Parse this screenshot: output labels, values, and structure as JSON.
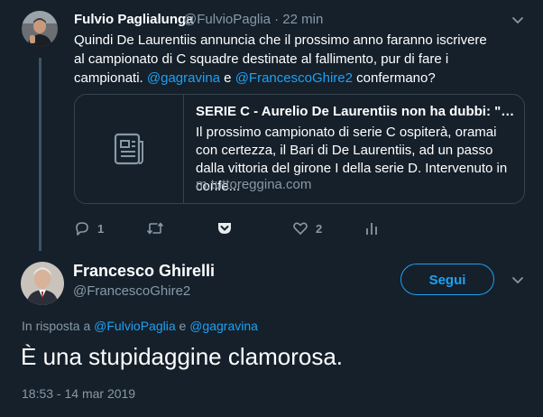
{
  "tweet1": {
    "display_name": "Fulvio Paglialunga",
    "handle": "@FulvioPaglia",
    "separator": "·",
    "time": "22 min",
    "body_part1": "Quindi De Laurentiis annuncia che il prossimo anno faranno iscrivere al campionato di C squadre destinate al fallimento, pur di fare i campionati.",
    "mention1": "@gagravina",
    "conj": "e",
    "mention2": "@FrancescoGhire2",
    "body_part2": "confermano?",
    "card": {
      "title": "SERIE C - Aurelio De Laurentiis non ha dubbi: \"Il pr...",
      "description": "Il prossimo campionato di serie C ospiterà, oramai con certezza, il Bari di De Laurentiis, ad un passo dalla vittoria del girone I della serie D. Intervenuto in confe...",
      "domain": "m.tuttoreggina.com",
      "thumb_icon": "document-icon"
    },
    "actions": {
      "reply_count": "1",
      "retweet_count": "",
      "like_count": "2"
    }
  },
  "tweet2": {
    "display_name": "Francesco Ghirelli",
    "handle": "@FrancescoGhire2",
    "follow_label": "Segui",
    "reply_prefix": "In risposta a",
    "reply_user1": "@FulvioPaglia",
    "reply_conj": "e",
    "reply_user2": "@gagravina",
    "text": "È una stupidaggine clamorosa.",
    "timestamp": "18:53 - 14 mar 2019"
  },
  "colors": {
    "background": "#15202b",
    "accent": "#1da1f2",
    "muted": "#8899a6",
    "border": "#38444d"
  }
}
